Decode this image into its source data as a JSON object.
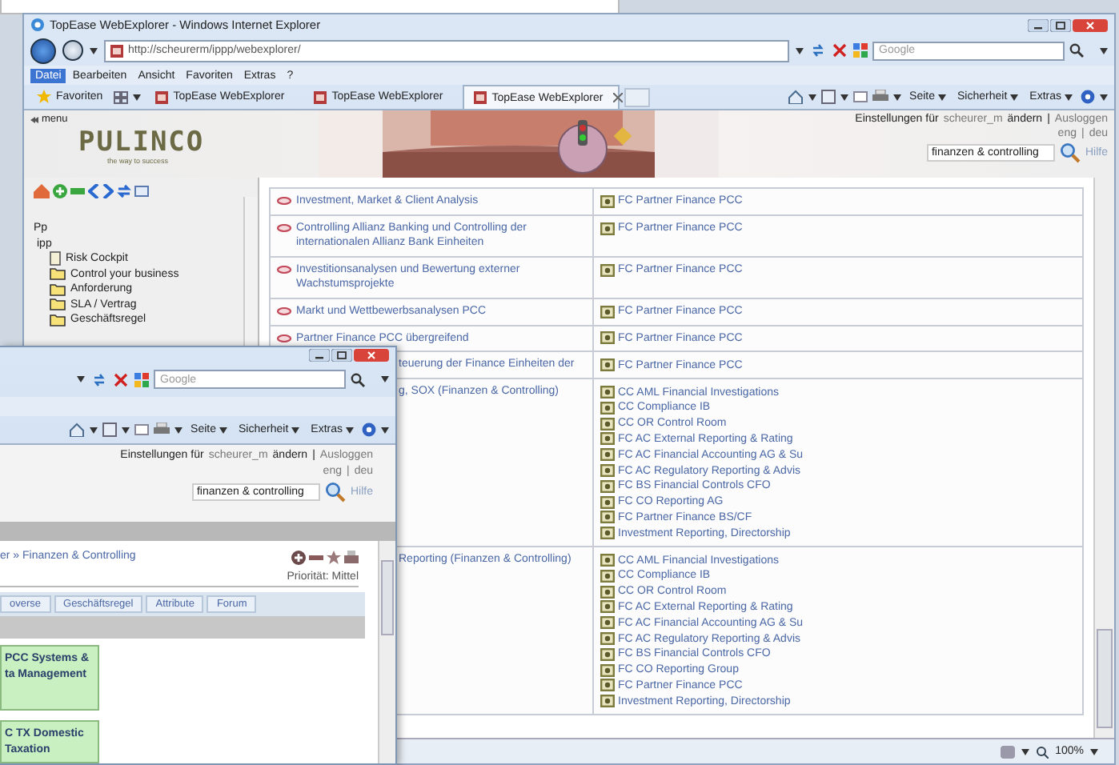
{
  "window": {
    "title": "TopEase WebExplorer - Windows Internet Explorer"
  },
  "address_bar": {
    "url": "http://scheurerm/ippp/webexplorer/",
    "search_placeholder": "Google"
  },
  "menu_bar": [
    {
      "label": "Datei",
      "selected": true
    },
    {
      "label": "Bearbeiten",
      "selected": false
    },
    {
      "label": "Ansicht",
      "selected": false
    },
    {
      "label": "Favoriten",
      "selected": false
    },
    {
      "label": "Extras",
      "selected": false
    },
    {
      "label": "?",
      "selected": false
    }
  ],
  "favorites_label": "Favoriten",
  "tabs": [
    {
      "label": "TopEase WebExplorer",
      "selected": false
    },
    {
      "label": "TopEase WebExplorer",
      "selected": false
    },
    {
      "label": "TopEase WebExplorer",
      "selected": true
    }
  ],
  "command_bar": [
    "Seite",
    "Sicherheit",
    "Extras"
  ],
  "page": {
    "menu_label": "menu",
    "logo": "PULINCO",
    "tagline": "the way to success",
    "settings_prefix": "Einstellungen für",
    "user": "scheurer_m",
    "change": "ändern",
    "separator": "|",
    "logout": "Ausloggen",
    "languages": [
      "eng",
      "deu"
    ],
    "search_value": "finanzen & controlling",
    "help": "Hilfe"
  },
  "tree": {
    "root": "Pp",
    "children": [
      {
        "label": "ipp",
        "children": [
          {
            "label": "Risk Cockpit",
            "kind": "document"
          },
          {
            "label": "Control your business",
            "kind": "folder"
          },
          {
            "label": "Anforderung",
            "kind": "folder"
          },
          {
            "label": "SLA / Vertrag",
            "kind": "folder"
          },
          {
            "label": "Geschäftsregel",
            "kind": "folder"
          }
        ]
      }
    ]
  },
  "table": {
    "rows": [
      {
        "kind": "link",
        "title": "Investment, Market & Client Analysis",
        "units": [
          "FC Partner Finance PCC"
        ]
      },
      {
        "kind": "link",
        "title": "Controlling Allianz Banking und Controlling der internationalen Allianz Bank Einheiten",
        "units": [
          "FC Partner Finance PCC"
        ]
      },
      {
        "kind": "link",
        "title": "Investitionsanalysen und Bewertung externer Wachstumsprojekte",
        "units": [
          "FC Partner Finance PCC"
        ]
      },
      {
        "kind": "link",
        "title": "Markt und Wettbewerbsanalysen PCC",
        "units": [
          "FC Partner Finance PCC"
        ]
      },
      {
        "kind": "link",
        "title": "Partner Finance PCC übergreifend",
        "units": [
          "FC Partner Finance PCC"
        ]
      },
      {
        "kind": "fragment",
        "title": "teuerung der Finance Einheiten der",
        "units": [
          "FC Partner Finance PCC"
        ]
      },
      {
        "kind": "fragment",
        "title": "g, SOX (Finanzen & Controlling)",
        "units": [
          "CC AML Financial Investigations",
          "CC Compliance IB",
          "CC OR Control Room",
          "FC AC External Reporting & Rating",
          "FC AC Financial Accounting AG & Su",
          "FC AC Regulatory Reporting & Advis",
          "FC BS Financial Controls CFO",
          "FC CO Reporting AG",
          "FC Partner Finance BS/CF",
          "Investment Reporting, Directorship"
        ]
      },
      {
        "kind": "fragment",
        "title": "Reporting (Finanzen & Controlling)",
        "units": [
          "CC AML Financial Investigations",
          "CC Compliance IB",
          "CC OR Control Room",
          "FC AC External Reporting & Rating",
          "FC AC Financial Accounting AG & Su",
          "FC AC Regulatory Reporting & Advis",
          "FC BS Financial Controls CFO",
          "FC CO Reporting Group",
          "FC Partner Finance PCC",
          "Investment Reporting, Directorship"
        ]
      }
    ]
  },
  "status_bar": {
    "zoom": "100%"
  },
  "second_window": {
    "search_placeholder": "Google",
    "command_bar": [
      "Seite",
      "Sicherheit",
      "Extras"
    ],
    "settings_prefix": "Einstellungen für",
    "user": "scheurer_m",
    "change": "ändern",
    "separator": "|",
    "logout": "Ausloggen",
    "languages": [
      "eng",
      "deu"
    ],
    "search_value": "finanzen & controlling",
    "help": "Hilfe",
    "breadcrumb": "er » Finanzen & Controlling",
    "priority": "Priorität: Mittel",
    "tabs": [
      {
        "label": "overse",
        "selected": false
      },
      {
        "label": "Geschäftsregel",
        "selected": false
      },
      {
        "label": "Attribute",
        "selected": false
      },
      {
        "label": "Forum",
        "selected": false
      }
    ],
    "boxes": [
      {
        "lines": [
          "PCC Systems &",
          "ta Management"
        ]
      },
      {
        "lines": [
          "C TX Domestic",
          "Taxation"
        ]
      }
    ]
  }
}
